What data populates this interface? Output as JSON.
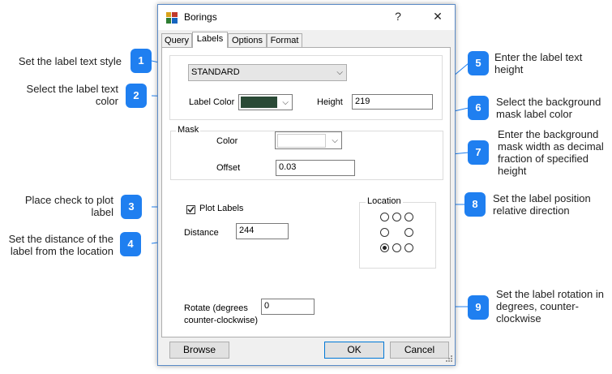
{
  "dialog": {
    "title": "Borings",
    "help_label": "?",
    "close_label": "✕"
  },
  "tabs": [
    {
      "label": "Query"
    },
    {
      "label": "Labels"
    },
    {
      "label": "Options"
    },
    {
      "label": "Format"
    }
  ],
  "labels_tab": {
    "text_style": "STANDARD",
    "label_color_label": "Label Color",
    "label_color_value": "#2a4a36",
    "height_label": "Height",
    "height_value": "219",
    "mask_group_label": "Mask",
    "mask_color_label": "Color",
    "offset_label": "Offset",
    "offset_value": "0.03",
    "plot_labels_label": "Plot Labels",
    "plot_labels_checked": true,
    "distance_label": "Distance",
    "distance_value": "244",
    "location_group_label": "Location",
    "location_selected": "bottom-left",
    "rotate_label_line1": "Rotate (degrees",
    "rotate_label_line2": "counter-clockwise)",
    "rotate_value": "0"
  },
  "footer": {
    "browse_label": "Browse",
    "ok_label": "OK",
    "cancel_label": "Cancel"
  },
  "callouts": [
    {
      "number": "1",
      "text": "Set the label text style"
    },
    {
      "number": "2",
      "text_line1": "Select the label text",
      "text_line2": "color"
    },
    {
      "number": "3",
      "text_line1": "Place check to plot",
      "text_line2": "label"
    },
    {
      "number": "4",
      "text_line1": "Set the distance of the",
      "text_line2": "label from the location"
    },
    {
      "number": "5",
      "text_line1": "Enter the label text",
      "text_line2": "height"
    },
    {
      "number": "6",
      "text_line1": "Select the background",
      "text_line2": "mask label color"
    },
    {
      "number": "7",
      "text_line1": "Enter the background",
      "text_line2": "mask width as decimal",
      "text_line3": "fraction of specified",
      "text_line4": "height"
    },
    {
      "number": "8",
      "text_line1": "Set the label position",
      "text_line2": "relative direction"
    },
    {
      "number": "9",
      "text_line1": "Set the label rotation in",
      "text_line2": "degrees, counter-",
      "text_line3": "clockwise"
    }
  ],
  "colors": {
    "callout_blue": "#1f7ff0",
    "window_border": "#5a8ac6"
  }
}
